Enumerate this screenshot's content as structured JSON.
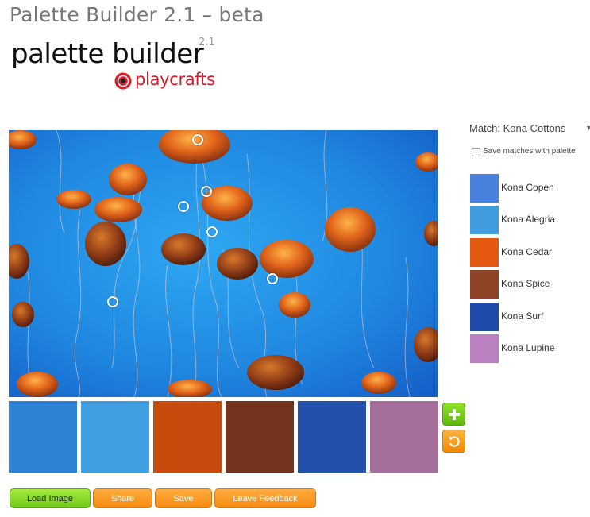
{
  "app": {
    "title": "Palette Builder 2.1 – beta"
  },
  "logo": {
    "wordmark": "palette builder",
    "version": "2.1",
    "brand": "playcrafts"
  },
  "palette": {
    "swatches": [
      {
        "color": "#2f83d6"
      },
      {
        "color": "#409fe0"
      },
      {
        "color": "#c64b0c"
      },
      {
        "color": "#73331d"
      },
      {
        "color": "#2350aa"
      },
      {
        "color": "#a56f9b"
      }
    ]
  },
  "actions": {
    "add_icon": "plus-icon",
    "reset_icon": "undo-icon",
    "load_image": "Load Image",
    "share": "Share",
    "save": "Save",
    "leave_feedback": "Leave Feedback"
  },
  "match": {
    "label": "Match: Kona Cottons",
    "save_matches_label": "Save matches with palette",
    "save_matches_checked": false,
    "results": [
      {
        "name": "Kona Copen",
        "color": "#4781dd"
      },
      {
        "name": "Kona Alegria",
        "color": "#3f9cdd"
      },
      {
        "name": "Kona Cedar",
        "color": "#e4590f"
      },
      {
        "name": "Kona Spice",
        "color": "#8e4327"
      },
      {
        "name": "Kona Surf",
        "color": "#204aa9"
      },
      {
        "name": "Kona Lupine",
        "color": "#bb80bf"
      }
    ]
  }
}
